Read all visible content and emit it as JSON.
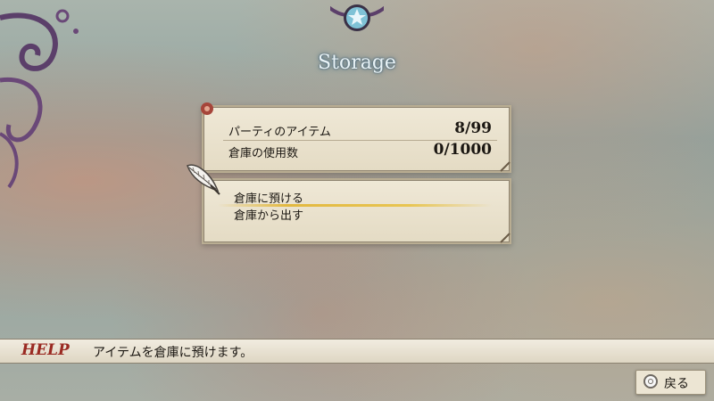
{
  "screen": {
    "title": "Storage"
  },
  "storage_info": {
    "party_items_label": "パーティのアイテム",
    "party_items_value": "8/99",
    "storage_used_label": "倉庫の使用数",
    "storage_used_value": "0/1000"
  },
  "menu": {
    "items": [
      {
        "label": "倉庫に預ける",
        "selected": true
      },
      {
        "label": "倉庫から出す",
        "selected": false
      }
    ]
  },
  "help": {
    "label": "HELP",
    "text": "アイテムを倉庫に預けます。"
  },
  "back_button": {
    "label": "戻る",
    "icon": "circle-button-icon"
  },
  "colors": {
    "help_label": "#9a2a22",
    "selection_highlight": "#e2b83f",
    "panel_bg": "#ebe3cf",
    "title_glow": "#3f6a86"
  }
}
